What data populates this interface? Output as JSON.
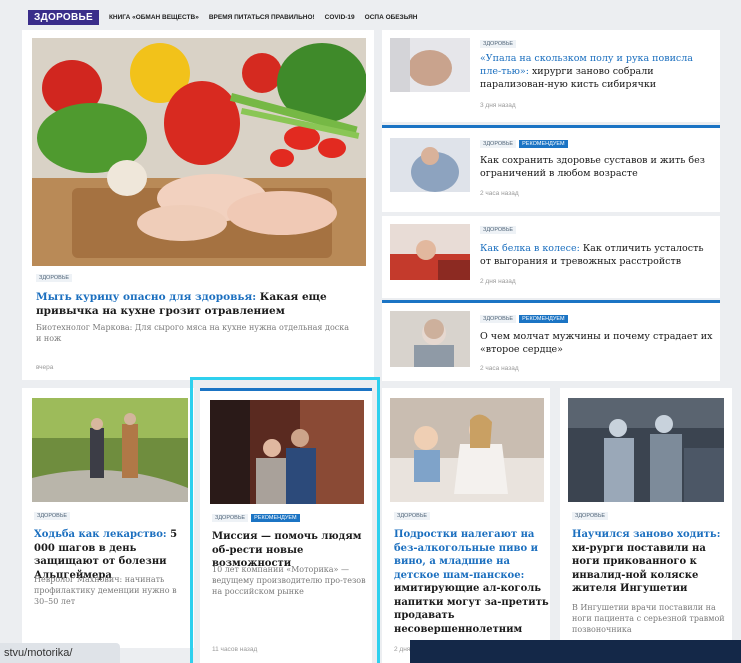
{
  "nav": {
    "logo": "ЗДОРОВЬЕ",
    "links": [
      "КНИГА «ОБМАН ВЕЩЕСТВ»",
      "ВРЕМЯ ПИТАТЬСЯ ПРАВИЛЬНО!",
      "COVID-19",
      "ОСПА ОБЕЗЬЯН"
    ]
  },
  "main": {
    "tag": "ЗДОРОВЬЕ",
    "title_accent": "Мыть курицу опасно для здоровья:",
    "title_rest": " Какая еще привычка на кухне грозит отравлением",
    "lead": "Биотехнолог Маркова: Для сырого мяса на кухне нужна отдельная доска и нож",
    "time": "вчера"
  },
  "side": [
    {
      "tags": [
        "ЗДОРОВЬЕ"
      ],
      "title_accent": "«Упала на скользком полу и рука повисла пле-тью»:",
      "title_rest": " хирурги заново собрали парализован-ную кисть сибирячки",
      "time": "3 дня назад"
    },
    {
      "tags": [
        "ЗДОРОВЬЕ",
        "РЕКОМЕНДУЕМ"
      ],
      "title_accent": "",
      "title_rest": "Как сохранить здоровье суставов и жить без ограничений в любом возрасте",
      "time": "2 часа назад"
    },
    {
      "tags": [
        "ЗДОРОВЬЕ"
      ],
      "title_accent": "Как белка в колесе:",
      "title_rest": " Как отличить усталость от выгорания и тревожных расстройств",
      "time": "2 дня назад"
    },
    {
      "tags": [
        "ЗДОРОВЬЕ",
        "РЕКОМЕНДУЕМ"
      ],
      "title_accent": "",
      "title_rest": "О чем молчат мужчины и почему страдает их «второе сердце»",
      "time": "2 часа назад"
    }
  ],
  "bottom": [
    {
      "tags": [
        "ЗДОРОВЬЕ"
      ],
      "title_accent": "Ходьба как лекарство:",
      "title_rest": " 5 000 шагов в день защищают от болезни Альцгеймера",
      "lead": "Невролог Махнович: начинать профилактику деменции нужно в 30–50 лет",
      "time": ""
    },
    {
      "tags": [
        "ЗДОРОВЬЕ",
        "РЕКОМЕНДУЕМ"
      ],
      "title_accent": "",
      "title_rest": "Миссия — помочь людям об-рести новые возможности",
      "lead": "10 лет компании «Моторика» — ведущему производителю про-тезов на российском рынке",
      "time": "11 часов назад"
    },
    {
      "tags": [
        "ЗДОРОВЬЕ"
      ],
      "title_accent": "Подростки налегают на без-алкогольные пиво и вино, а младшие на детское шам-панское:",
      "title_rest": " имитирующие ал-коголь напитки могут за-претить продавать несовершеннолетним",
      "lead": "",
      "time": "2 дня назад"
    },
    {
      "tags": [
        "ЗДОРОВЬЕ"
      ],
      "title_accent": "Научился заново ходить:",
      "title_rest": " хи-рурги поставили на ноги прикованного к инвалид-ной коляске жителя Ингушетии",
      "lead": "В Ингушетии врачи поставили на ноги пациента с серьезной травмой позвоночника",
      "time": ""
    }
  ],
  "status": {
    "url": "stvu/motorika/"
  }
}
